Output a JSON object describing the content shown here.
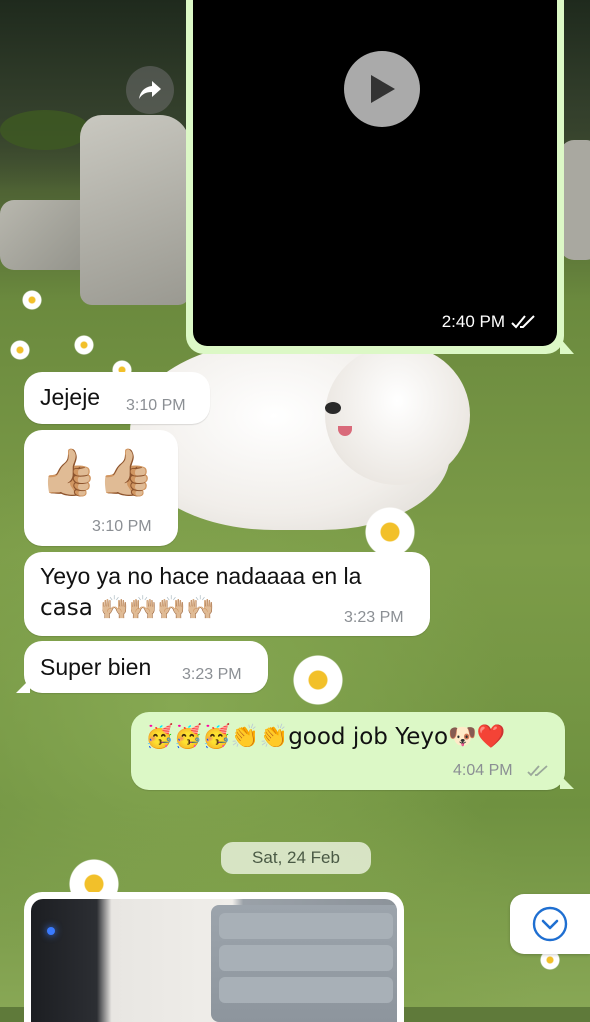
{
  "chat": {
    "video_message": {
      "time": "2:40 PM",
      "status_icon": "double-check-icon",
      "play_icon": "play-icon"
    },
    "forward_icon": "forward-arrow-icon",
    "messages": [
      {
        "side": "incoming",
        "text": "Jejeje",
        "time": "3:10 PM"
      },
      {
        "side": "incoming",
        "emoji": "👍🏼👍🏼",
        "time": "3:10 PM"
      },
      {
        "side": "incoming",
        "text_line1": "Yeyo ya no hace nadaaaa en la",
        "text_line2": "casa 🙌🏼🙌🏼🙌🏼🙌🏼",
        "time": "3:23 PM"
      },
      {
        "side": "incoming",
        "text": "Super bien",
        "time": "3:23 PM"
      },
      {
        "side": "outgoing",
        "text": "🥳🥳🥳👏👏good job Yeyo🐶❤️",
        "time": "4:04 PM"
      }
    ],
    "date_separator": "Sat, 24 Feb",
    "scroll_to_bottom_icon": "chevron-down-circle-icon"
  }
}
